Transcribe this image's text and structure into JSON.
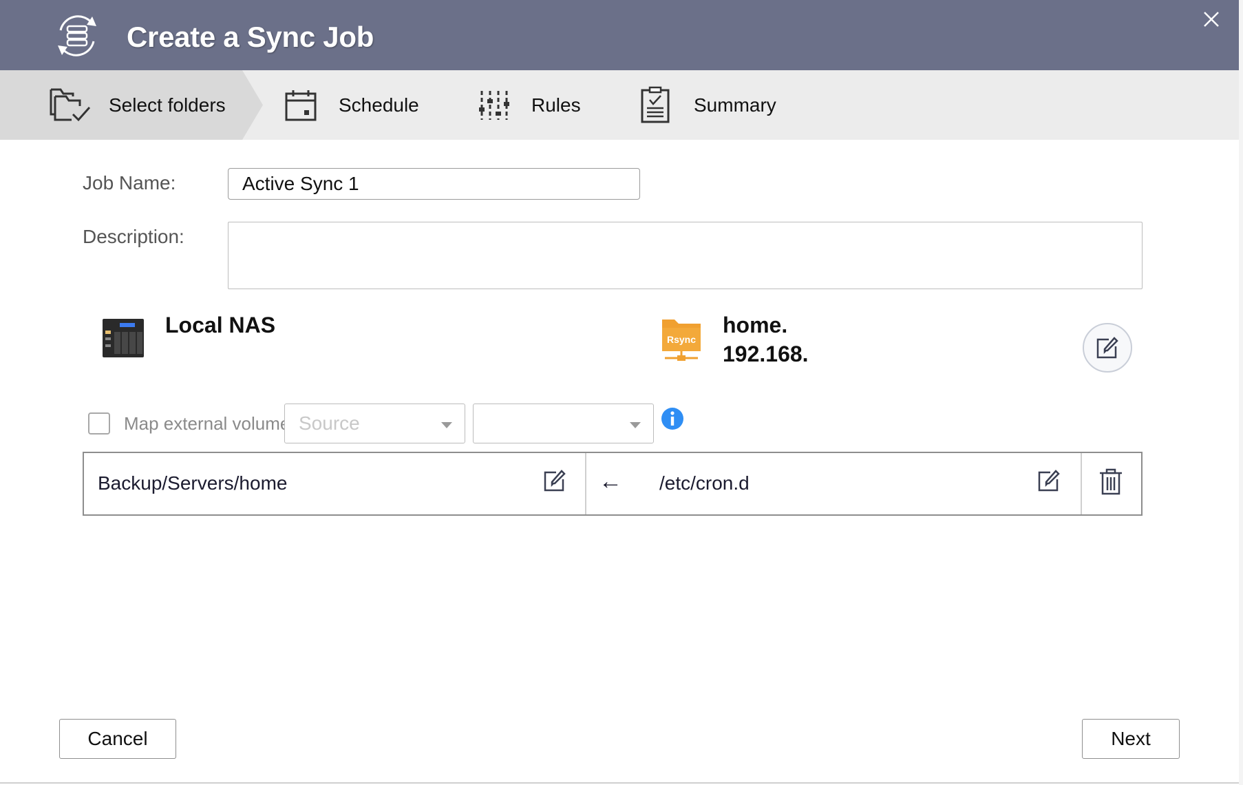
{
  "dialog": {
    "title": "Create a Sync Job",
    "close_label": "×"
  },
  "steps": [
    {
      "label": "Select folders",
      "active": true,
      "icon": "folders-check-icon"
    },
    {
      "label": "Schedule",
      "active": false,
      "icon": "calendar-icon"
    },
    {
      "label": "Rules",
      "active": false,
      "icon": "sliders-icon"
    },
    {
      "label": "Summary",
      "active": false,
      "icon": "clipboard-check-icon"
    }
  ],
  "form": {
    "job_name_label": "Job Name:",
    "job_name_value": "Active Sync 1",
    "description_label": "Description:",
    "description_value": ""
  },
  "local": {
    "title": "Local NAS",
    "icon": "nas-device-icon"
  },
  "remote": {
    "line1": "home.",
    "line2": "192.168.",
    "icon": "rsync-folder-icon",
    "icon_text": "Rsync"
  },
  "mapping": {
    "checkbox_label": "Map external volume",
    "checked": false,
    "source_placeholder": "Source",
    "target_value": ""
  },
  "folder_pair": {
    "local_path": "Backup/Servers/home",
    "direction": "←",
    "remote_path": "/etc/cron.d"
  },
  "buttons": {
    "cancel": "Cancel",
    "next": "Next"
  },
  "colors": {
    "titlebar": "#6b7089",
    "stepbar": "#ececec",
    "active_step": "#d9d9d9",
    "rsync_orange": "#f0a030",
    "info_blue": "#2f8ef4"
  }
}
